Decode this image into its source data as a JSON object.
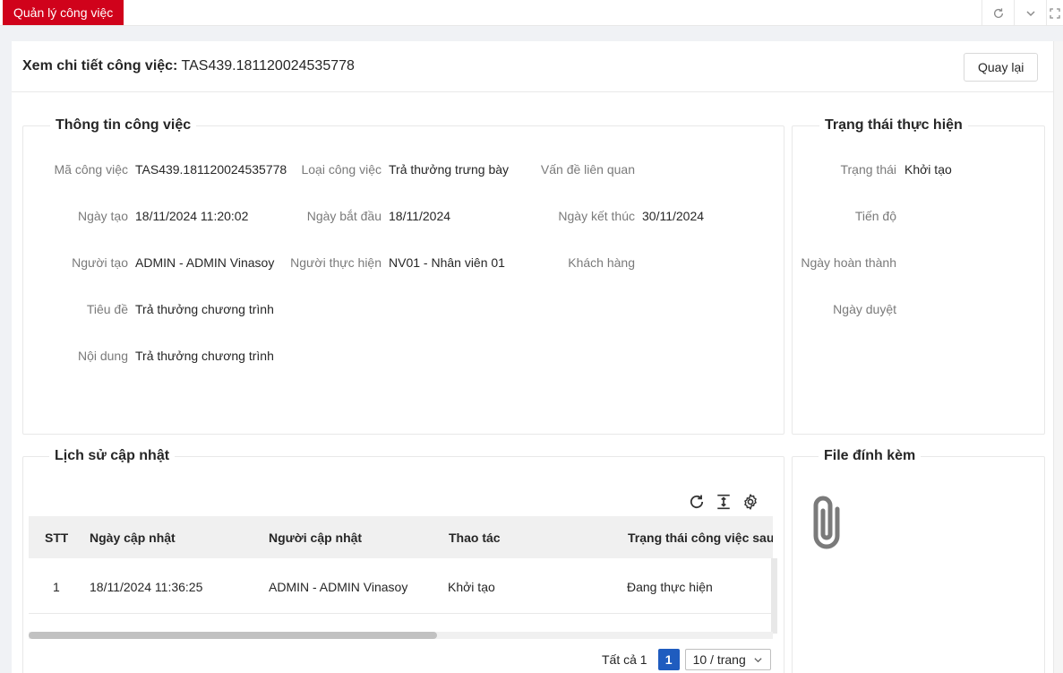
{
  "tabbar": {
    "active_tab": "Quản lý công việc",
    "icons": [
      "reload-icon",
      "chevron-down-icon",
      "fullscreen-icon"
    ]
  },
  "header": {
    "title_label": "Xem chi tiết công việc:",
    "title_value": "TAS439.181120024535778",
    "back_button": "Quay lại"
  },
  "task_info": {
    "legend": "Thông tin công việc",
    "fields": [
      {
        "label": "Mã công việc",
        "value": "TAS439.181120024535778"
      },
      {
        "label": "Loại công việc",
        "value": "Trả thưởng trưng bày"
      },
      {
        "label": "Vấn đề liên quan",
        "value": ""
      },
      {
        "label": "Ngày tạo",
        "value": "18/11/2024 11:20:02"
      },
      {
        "label": "Ngày bắt đầu",
        "value": "18/11/2024"
      },
      {
        "label": "Ngày kết thúc",
        "value": "30/11/2024"
      },
      {
        "label": "Người tạo",
        "value": "ADMIN - ADMIN Vinasoy"
      },
      {
        "label": "Người thực hiện",
        "value": "NV01 - Nhân viên 01"
      },
      {
        "label": "Khách hàng",
        "value": ""
      },
      {
        "label": "Tiêu đề",
        "value": "Trả thưởng chương trình"
      },
      {
        "label": "Nội dung",
        "value": "Trả thưởng chương trình"
      }
    ]
  },
  "status_info": {
    "legend": "Trạng thái thực hiện",
    "fields": [
      {
        "label": "Trạng thái",
        "value": "Khởi tạo"
      },
      {
        "label": "Tiến độ",
        "value": ""
      },
      {
        "label": "Ngày hoàn thành",
        "value": ""
      },
      {
        "label": "Ngày duyệt",
        "value": ""
      }
    ]
  },
  "history": {
    "legend": "Lịch sử cập nhật",
    "toolbar_icons": [
      "reload-icon",
      "column-height-icon",
      "settings-icon"
    ],
    "columns": [
      "STT",
      "Ngày cập nhật",
      "Người cập nhật",
      "Thao tác",
      "Trạng thái công việc sau"
    ],
    "rows": [
      [
        "1",
        "18/11/2024 11:36:25",
        "ADMIN - ADMIN Vinasoy",
        "Khởi tạo",
        "Đang thực hiện"
      ]
    ],
    "pagination": {
      "total": "Tất cả 1",
      "current_page": "1",
      "page_size": "10 / trang"
    }
  },
  "attachments": {
    "legend": "File đính kèm",
    "icon": "paperclip-icon"
  },
  "colors": {
    "tab_active": "#d0021b",
    "page_active": "#1f5cbf",
    "label_gray": "#7a7a7a",
    "table_header_bg": "#f0f0f0"
  }
}
